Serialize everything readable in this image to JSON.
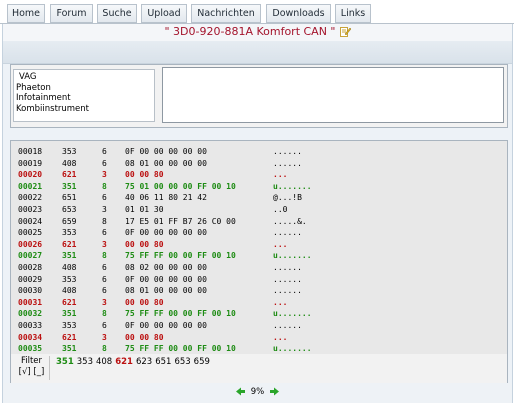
{
  "nav": {
    "tabs": [
      {
        "label": "Home"
      },
      {
        "label": "Forum"
      },
      {
        "label": "Suche"
      },
      {
        "label": "Upload"
      },
      {
        "label": "Nachrichten"
      },
      {
        "label": "Downloads"
      },
      {
        "label": "Links"
      }
    ]
  },
  "title": "\" 3D0-920-881A Komfort CAN \"",
  "vehicle": {
    "lines": [
      "VAG",
      "Phaeton",
      "Infotainment",
      "Kombiinstrument"
    ]
  },
  "rows": [
    {
      "num": "00018",
      "id": "353",
      "len": "6",
      "data": "0F 00 00 00 00 00",
      "ascii": "......",
      "hl": ""
    },
    {
      "num": "00019",
      "id": "408",
      "len": "6",
      "data": "08 01 00 00 00 00",
      "ascii": "......",
      "hl": ""
    },
    {
      "num": "00020",
      "id": "621",
      "len": "3",
      "data": "00 00 80",
      "ascii": "...",
      "hl": "red"
    },
    {
      "num": "00021",
      "id": "351",
      "len": "8",
      "data": "75 01 00 00 00 FF 00 10",
      "ascii": "u.......",
      "hl": "green"
    },
    {
      "num": "00022",
      "id": "651",
      "len": "6",
      "data": "40 06 11 80 21 42",
      "ascii": "@...!B",
      "hl": ""
    },
    {
      "num": "00023",
      "id": "653",
      "len": "3",
      "data": "01 01 30",
      "ascii": "..0",
      "hl": ""
    },
    {
      "num": "00024",
      "id": "659",
      "len": "8",
      "data": "17 E5 01 FF B7 26 C0 00",
      "ascii": ".....&.",
      "hl": ""
    },
    {
      "num": "00025",
      "id": "353",
      "len": "6",
      "data": "0F 00 00 00 00 00",
      "ascii": "......",
      "hl": ""
    },
    {
      "num": "00026",
      "id": "621",
      "len": "3",
      "data": "00 00 80",
      "ascii": "...",
      "hl": "red"
    },
    {
      "num": "00027",
      "id": "351",
      "len": "8",
      "data": "75 FF FF 00 00 FF 00 10",
      "ascii": "u.......",
      "hl": "green"
    },
    {
      "num": "00028",
      "id": "408",
      "len": "6",
      "data": "08 02 00 00 00 00",
      "ascii": "......",
      "hl": ""
    },
    {
      "num": "00029",
      "id": "353",
      "len": "6",
      "data": "0F 00 00 00 00 00",
      "ascii": "......",
      "hl": ""
    },
    {
      "num": "00030",
      "id": "408",
      "len": "6",
      "data": "08 01 00 00 00 00",
      "ascii": "......",
      "hl": ""
    },
    {
      "num": "00031",
      "id": "621",
      "len": "3",
      "data": "00 00 80",
      "ascii": "...",
      "hl": "red"
    },
    {
      "num": "00032",
      "id": "351",
      "len": "8",
      "data": "75 FF FF 00 00 FF 00 10",
      "ascii": "u.......",
      "hl": "green"
    },
    {
      "num": "00033",
      "id": "353",
      "len": "6",
      "data": "0F 00 00 00 00 00",
      "ascii": "......",
      "hl": ""
    },
    {
      "num": "00034",
      "id": "621",
      "len": "3",
      "data": "00 00 80",
      "ascii": "...",
      "hl": "red"
    },
    {
      "num": "00035",
      "id": "351",
      "len": "8",
      "data": "75 FF FF 00 00 FF 00 10",
      "ascii": "u.......",
      "hl": "green"
    }
  ],
  "filter": {
    "label": "Filter",
    "toggles": "[√] [_]",
    "ids": [
      {
        "id": "351",
        "hl": "green"
      },
      {
        "id": "353",
        "hl": ""
      },
      {
        "id": "408",
        "hl": ""
      },
      {
        "id": "621",
        "hl": "red"
      },
      {
        "id": "623",
        "hl": ""
      },
      {
        "id": "651",
        "hl": ""
      },
      {
        "id": "653",
        "hl": ""
      },
      {
        "id": "659",
        "hl": ""
      }
    ]
  },
  "pager": {
    "percent": "9%"
  },
  "colors": {
    "title": "#a4142c",
    "green": "#1e8c14",
    "red": "#bb1010"
  }
}
